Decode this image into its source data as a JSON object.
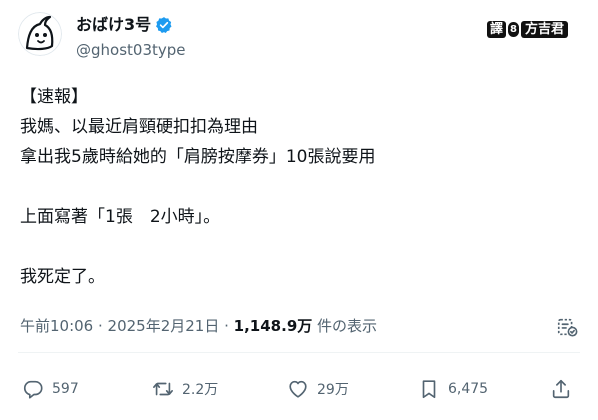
{
  "author": {
    "display_name": "おばけ3号",
    "handle": "@ghost03type"
  },
  "watermark": {
    "box": "譯",
    "num": "8",
    "text": "方吉君"
  },
  "tweet": {
    "lines": [
      "【速報】",
      "我媽、以最近肩頸硬扣扣為理由",
      "拿出我5歲時給她的「肩膀按摩券」10張說要用",
      "",
      "上面寫著「1張　2小時」。",
      "",
      "我死定了。"
    ]
  },
  "meta": {
    "time": "午前10:06",
    "separator": " · ",
    "date": "2025年2月21日",
    "views_count": "1,148.9万",
    "views_label": " 件の表示"
  },
  "actions": {
    "reply_count": "597",
    "retweet_count": "2.2万",
    "like_count": "29万",
    "bookmark_count": "6,475"
  },
  "icons": {
    "verified": "verified-badge-icon",
    "reply": "reply-icon",
    "retweet": "retweet-icon",
    "like": "heart-icon",
    "bookmark": "bookmark-icon",
    "share": "share-icon",
    "analytics": "analytics-icon"
  },
  "colors": {
    "text": "#0f1419",
    "secondary": "#536471",
    "verified": "#1d9bf0",
    "divider": "#eff3f4"
  }
}
